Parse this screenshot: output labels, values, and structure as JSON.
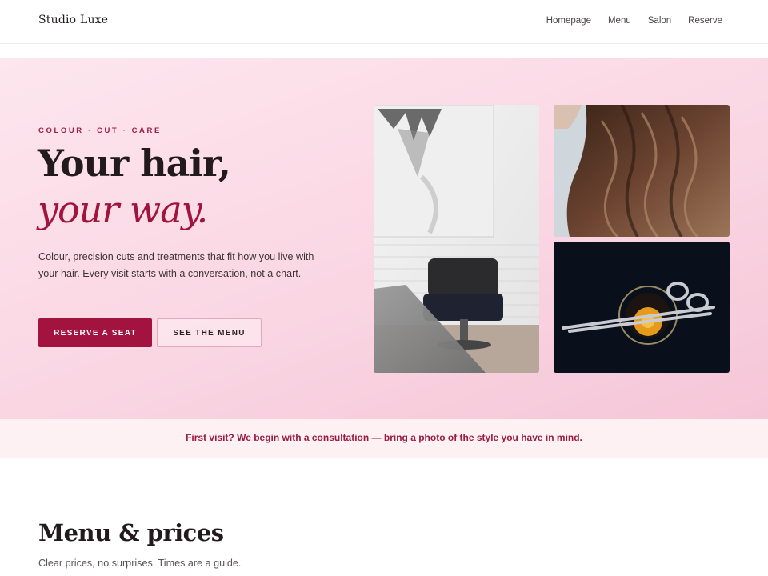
{
  "header": {
    "brand": "Studio Luxe",
    "nav": [
      "Homepage",
      "Menu",
      "Salon",
      "Reserve"
    ]
  },
  "hero": {
    "eyebrow": "COLOUR · CUT · CARE",
    "headline_line1": "Your hair,",
    "headline_line2": "your way.",
    "lede": "Colour, precision cuts and treatments that fit how you live with your hair. Every visit starts with a conversation, not a chart.",
    "primary_button": "RESERVE A SEAT",
    "secondary_button": "SEE THE MENU"
  },
  "notice": {
    "text": "First visit? We begin with a consultation — bring a photo of the style you have in mind."
  },
  "menu_section": {
    "title": "Menu & prices",
    "subtitle": "Clear prices, no surprises. Times are a guide."
  },
  "colors": {
    "accent": "#a2143f",
    "hero_bg": "#fad6e3",
    "notice_bg": "#fdf1f4"
  }
}
